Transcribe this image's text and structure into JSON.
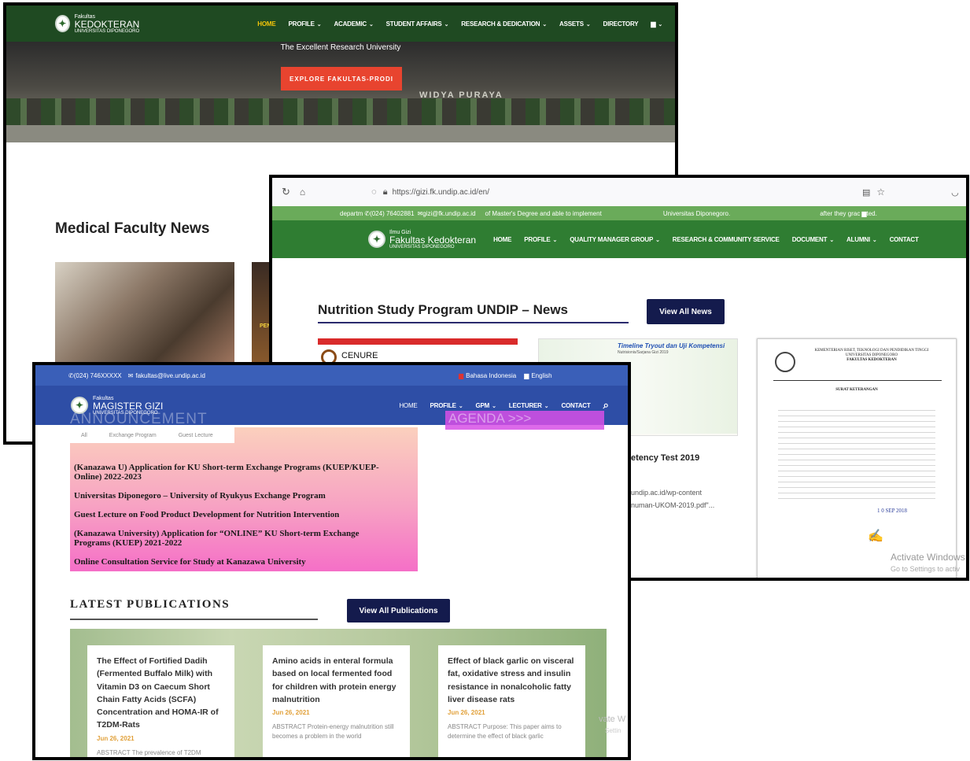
{
  "fk": {
    "brand_pre": "Fakultas",
    "brand_main": "KEDOKTERAN",
    "brand_sub": "UNIVERSITAS DIPONEGORO",
    "nav": [
      "HOME",
      "PROFILE",
      "ACADEMIC",
      "STUDENT AFFAIRS",
      "RESEARCH & DEDICATION",
      "ASSETS",
      "DIRECTORY"
    ],
    "tagline": "The Excellent Research University",
    "explore_button": "EXPLORE FAKULTAS-PRODI",
    "building_sign": "WIDYA PURAYA",
    "news_heading": "Medical Faculty News",
    "photo2_text": "PEN"
  },
  "gizi": {
    "url": "https://gizi.fk.undip.ac.id/en/",
    "strip_items": [
      "departm",
      "(024) 76402881",
      "gizi@fk.undip.ac.id",
      "of Master's Degree and able to implement",
      "Universitas Diponegoro.",
      "after they grac",
      "ted."
    ],
    "brand_pre": "Ilmu Gizi",
    "brand_main": "Fakultas Kedokteran",
    "brand_sub": "UNIVERSITAS DIPONEGORO",
    "nav": [
      "HOME",
      "PROFILE",
      "QUALITY MANAGER GROUP",
      "RESEARCH & COMMUNITY SERVICE",
      "DOCUMENT",
      "ALUMNI",
      "CONTACT"
    ],
    "news_heading": "Nutrition Study Program UNDIP – News",
    "view_all": "View All News",
    "card1_title": "CENURE",
    "card2_title": "Timeline Tryout dan Uji Kompetensi",
    "card2_sub": "Nutrisionis/Sarjana Gizi 2019",
    "card2_heading": "etency Test 2019",
    "card2_lines": [
      "undip.ac.id/wp-content",
      "numan-UKOM-2019.pdf\"..."
    ],
    "letter": {
      "org1": "KEMENTERIAN RISET, TEKNOLOGI DAN PENDIDIKAN TINGGI",
      "org2": "UNIVERSITAS DIPONEGORO",
      "org3": "FAKULTAS KEDOKTERAN",
      "title": "SURAT KETERANGAN",
      "date": "1 0 SEP 2018"
    },
    "activate": "Activate Windows",
    "activate_sub": "Go to Settings to activ"
  },
  "mg": {
    "phone": "(024) 746XXXXX",
    "email": "fakultas@live.undip.ac.id",
    "lang_id": "Bahasa Indonesia",
    "lang_en": "English",
    "brand_pre": "Fakultas",
    "brand_main": "MAGISTER GIZI",
    "brand_sub": "UNIVERSITAS DIPONEGORO",
    "nav": [
      "HOME",
      "PROFILE",
      "GPM",
      "LECTURER",
      "CONTACT"
    ],
    "announcement_ghost": "ANNOUNCEMENT",
    "agenda": "AGENDA >>>",
    "tabs": [
      "All",
      "Exchange Program",
      "Guest Lecture"
    ],
    "announcements": [
      "(Kanazawa U) Application for KU Short-term Exchange Programs (KUEP/KUEP-Online) 2022-2023",
      "Universitas Diponegoro – University of Ryukyus Exchange Program",
      "Guest Lecture on Food Product Development for Nutrition Intervention",
      "(Kanazawa University) Application for “ONLINE” KU Short-term Exchange Programs (KUEP) 2021-2022",
      "Online Consultation Service for Study at Kanazawa University"
    ],
    "pub_heading": "LATEST PUBLICATIONS",
    "view_pubs": "View All Publications",
    "publications": [
      {
        "title": "The Effect of Fortified Dadih (Fermented Buffalo Milk) with Vitamin D3 on Caecum Short Chain Fatty Acids (SCFA) Concentration and HOMA-IR of T2DM-Rats",
        "date": "Jun 26, 2021",
        "abstract": "ABSTRACT The prevalence of T2DM"
      },
      {
        "title": "Amino acids in enteral formula based on local fermented food for children with protein energy malnutrition",
        "date": "Jun 26, 2021",
        "abstract": "ABSTRACT Protein-energy malnutrition still becomes a problem in the world"
      },
      {
        "title": "Effect of black garlic on visceral fat, oxidative stress and insulin resistance in nonalcoholic fatty liver disease rats",
        "date": "Jun 26, 2021",
        "abstract": "ABSTRACT Purpose: This paper aims to determine the effect of black garlic"
      }
    ],
    "faint": "vate W",
    "faint2": "Settin"
  }
}
